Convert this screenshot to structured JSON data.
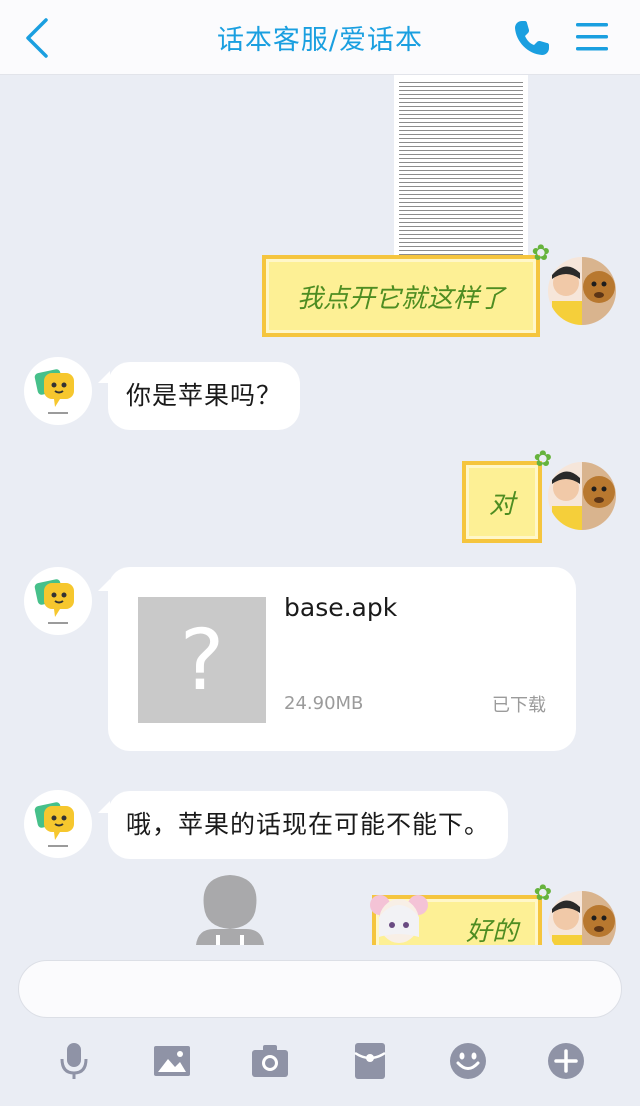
{
  "header": {
    "title": "话本客服/爱话本"
  },
  "messages": {
    "sticker1_text": "我点开它就这样了",
    "bubble1_text": "你是苹果吗？",
    "sticker2_text": "对",
    "file": {
      "name": "base.apk",
      "size": "24.90MB",
      "status": "已下载"
    },
    "bubble2_text": "哦，苹果的话现在可能不能下。",
    "sticker3_text": "好的"
  },
  "toolbar": {
    "icons": [
      "microphone-icon",
      "image-icon",
      "camera-icon",
      "red-packet-icon",
      "emoji-icon",
      "plus-icon"
    ]
  },
  "colors": {
    "accent": "#1a9fe0",
    "background": "#eaedf4",
    "icon_grey": "#8f93a6"
  }
}
